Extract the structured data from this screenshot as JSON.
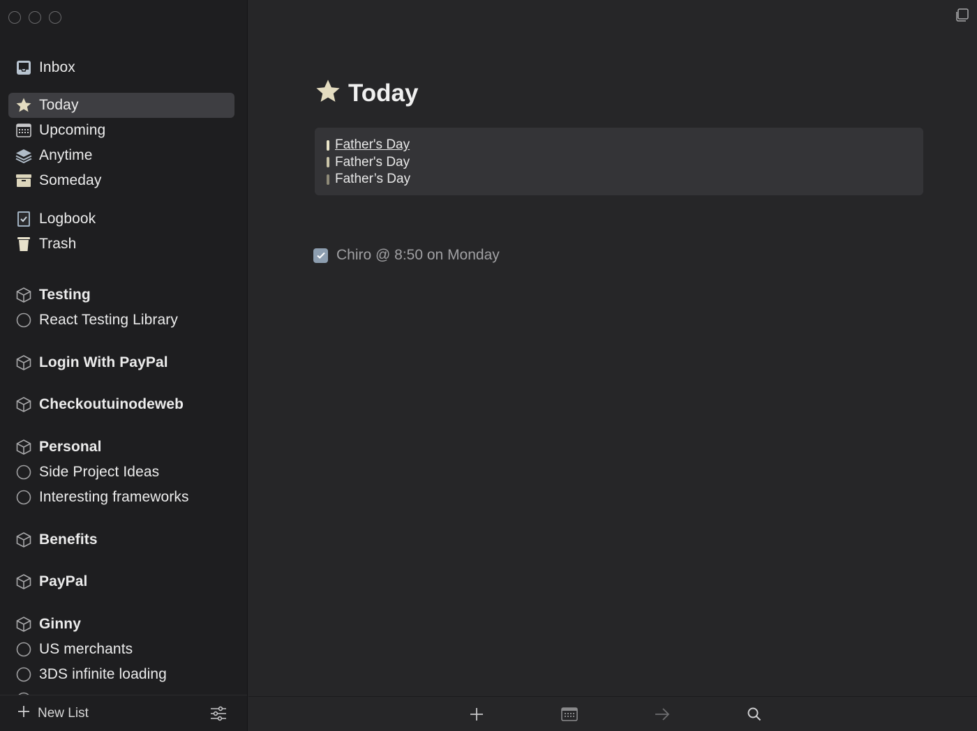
{
  "sidebar": {
    "inbox": "Inbox",
    "today": "Today",
    "upcoming": "Upcoming",
    "anytime": "Anytime",
    "someday": "Someday",
    "logbook": "Logbook",
    "trash": "Trash",
    "areas": [
      {
        "name": "Testing",
        "projects": [
          "React Testing Library"
        ]
      },
      {
        "name": "Login With PayPal",
        "projects": []
      },
      {
        "name": "Checkoutuinodeweb",
        "projects": []
      },
      {
        "name": "Personal",
        "projects": [
          "Side Project Ideas",
          "Interesting frameworks"
        ]
      },
      {
        "name": "Benefits",
        "projects": []
      },
      {
        "name": "PayPal",
        "projects": []
      },
      {
        "name": "Ginny",
        "projects": [
          "US merchants",
          "3DS infinite loading"
        ]
      }
    ],
    "new_list": "New List"
  },
  "main": {
    "title": "Today",
    "events": [
      "Father's Day",
      "Father's Day",
      "Father’s Day"
    ],
    "todos": [
      {
        "title": "Chiro @ 8:50 on Monday",
        "completed": true
      }
    ]
  },
  "colors": {
    "sidebar_bg": "#1e1e20",
    "main_bg": "#262628",
    "star": "#e4dcc0",
    "checkbox": "#8d9eb0"
  }
}
